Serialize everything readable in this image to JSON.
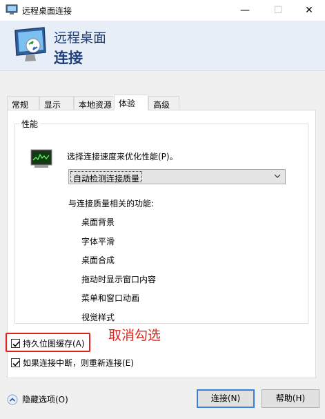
{
  "window": {
    "title": "远程桌面连接",
    "min_symbol": "—",
    "max_symbol": "☐",
    "close_symbol": "✕"
  },
  "header": {
    "line1": "远程桌面",
    "line2": "连接"
  },
  "tabs": [
    {
      "label": "常规"
    },
    {
      "label": "显示"
    },
    {
      "label": "本地资源"
    },
    {
      "label": "体验"
    },
    {
      "label": "高级"
    }
  ],
  "active_tab": "体验",
  "performance": {
    "legend": "性能",
    "prompt": "选择连接速度来优化性能(P)。",
    "selected": "自动检测连接质量",
    "features_label": "与连接质量相关的功能:",
    "features": [
      "桌面背景",
      "字体平滑",
      "桌面合成",
      "拖动时显示窗口内容",
      "菜单和窗口动画",
      "视觉样式"
    ]
  },
  "checkboxes": {
    "persistent_cache": {
      "label": "持久位图缓存(A)",
      "checked": true
    },
    "reconnect": {
      "label": "如果连接中断，则重新连接(E)",
      "checked": true
    }
  },
  "annotation": "取消勾选",
  "footer": {
    "hide_options": "隐藏选项(O)",
    "connect": "连接(N)",
    "help": "帮助(H)"
  },
  "colors": {
    "annotation": "#e0221b",
    "header_text": "#1f3f7a",
    "header_bg": "#e8eef7",
    "default_button_border": "#3c7ddc"
  }
}
